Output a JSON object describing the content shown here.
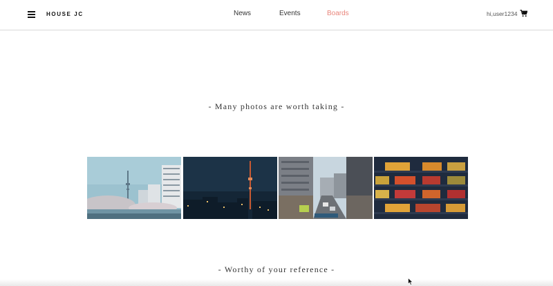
{
  "header": {
    "brand": "HOUSE JC",
    "nav": [
      {
        "label": "News",
        "active": false
      },
      {
        "label": "Events",
        "active": false
      },
      {
        "label": "Boards",
        "active": true
      }
    ],
    "user": "hi,user1234",
    "accent_color": "#e9857b"
  },
  "sections": {
    "photos_title": "- Many photos are worth taking -",
    "reference_title": "- Worthy of your reference -"
  },
  "photos": [
    {
      "subject": "Tokyo Skytree by the river with cherry blossoms"
    },
    {
      "subject": "Tokyo Skytree at night skyline"
    },
    {
      "subject": "City street traffic between buildings"
    },
    {
      "subject": "Building facade with lit colorful windows"
    }
  ]
}
